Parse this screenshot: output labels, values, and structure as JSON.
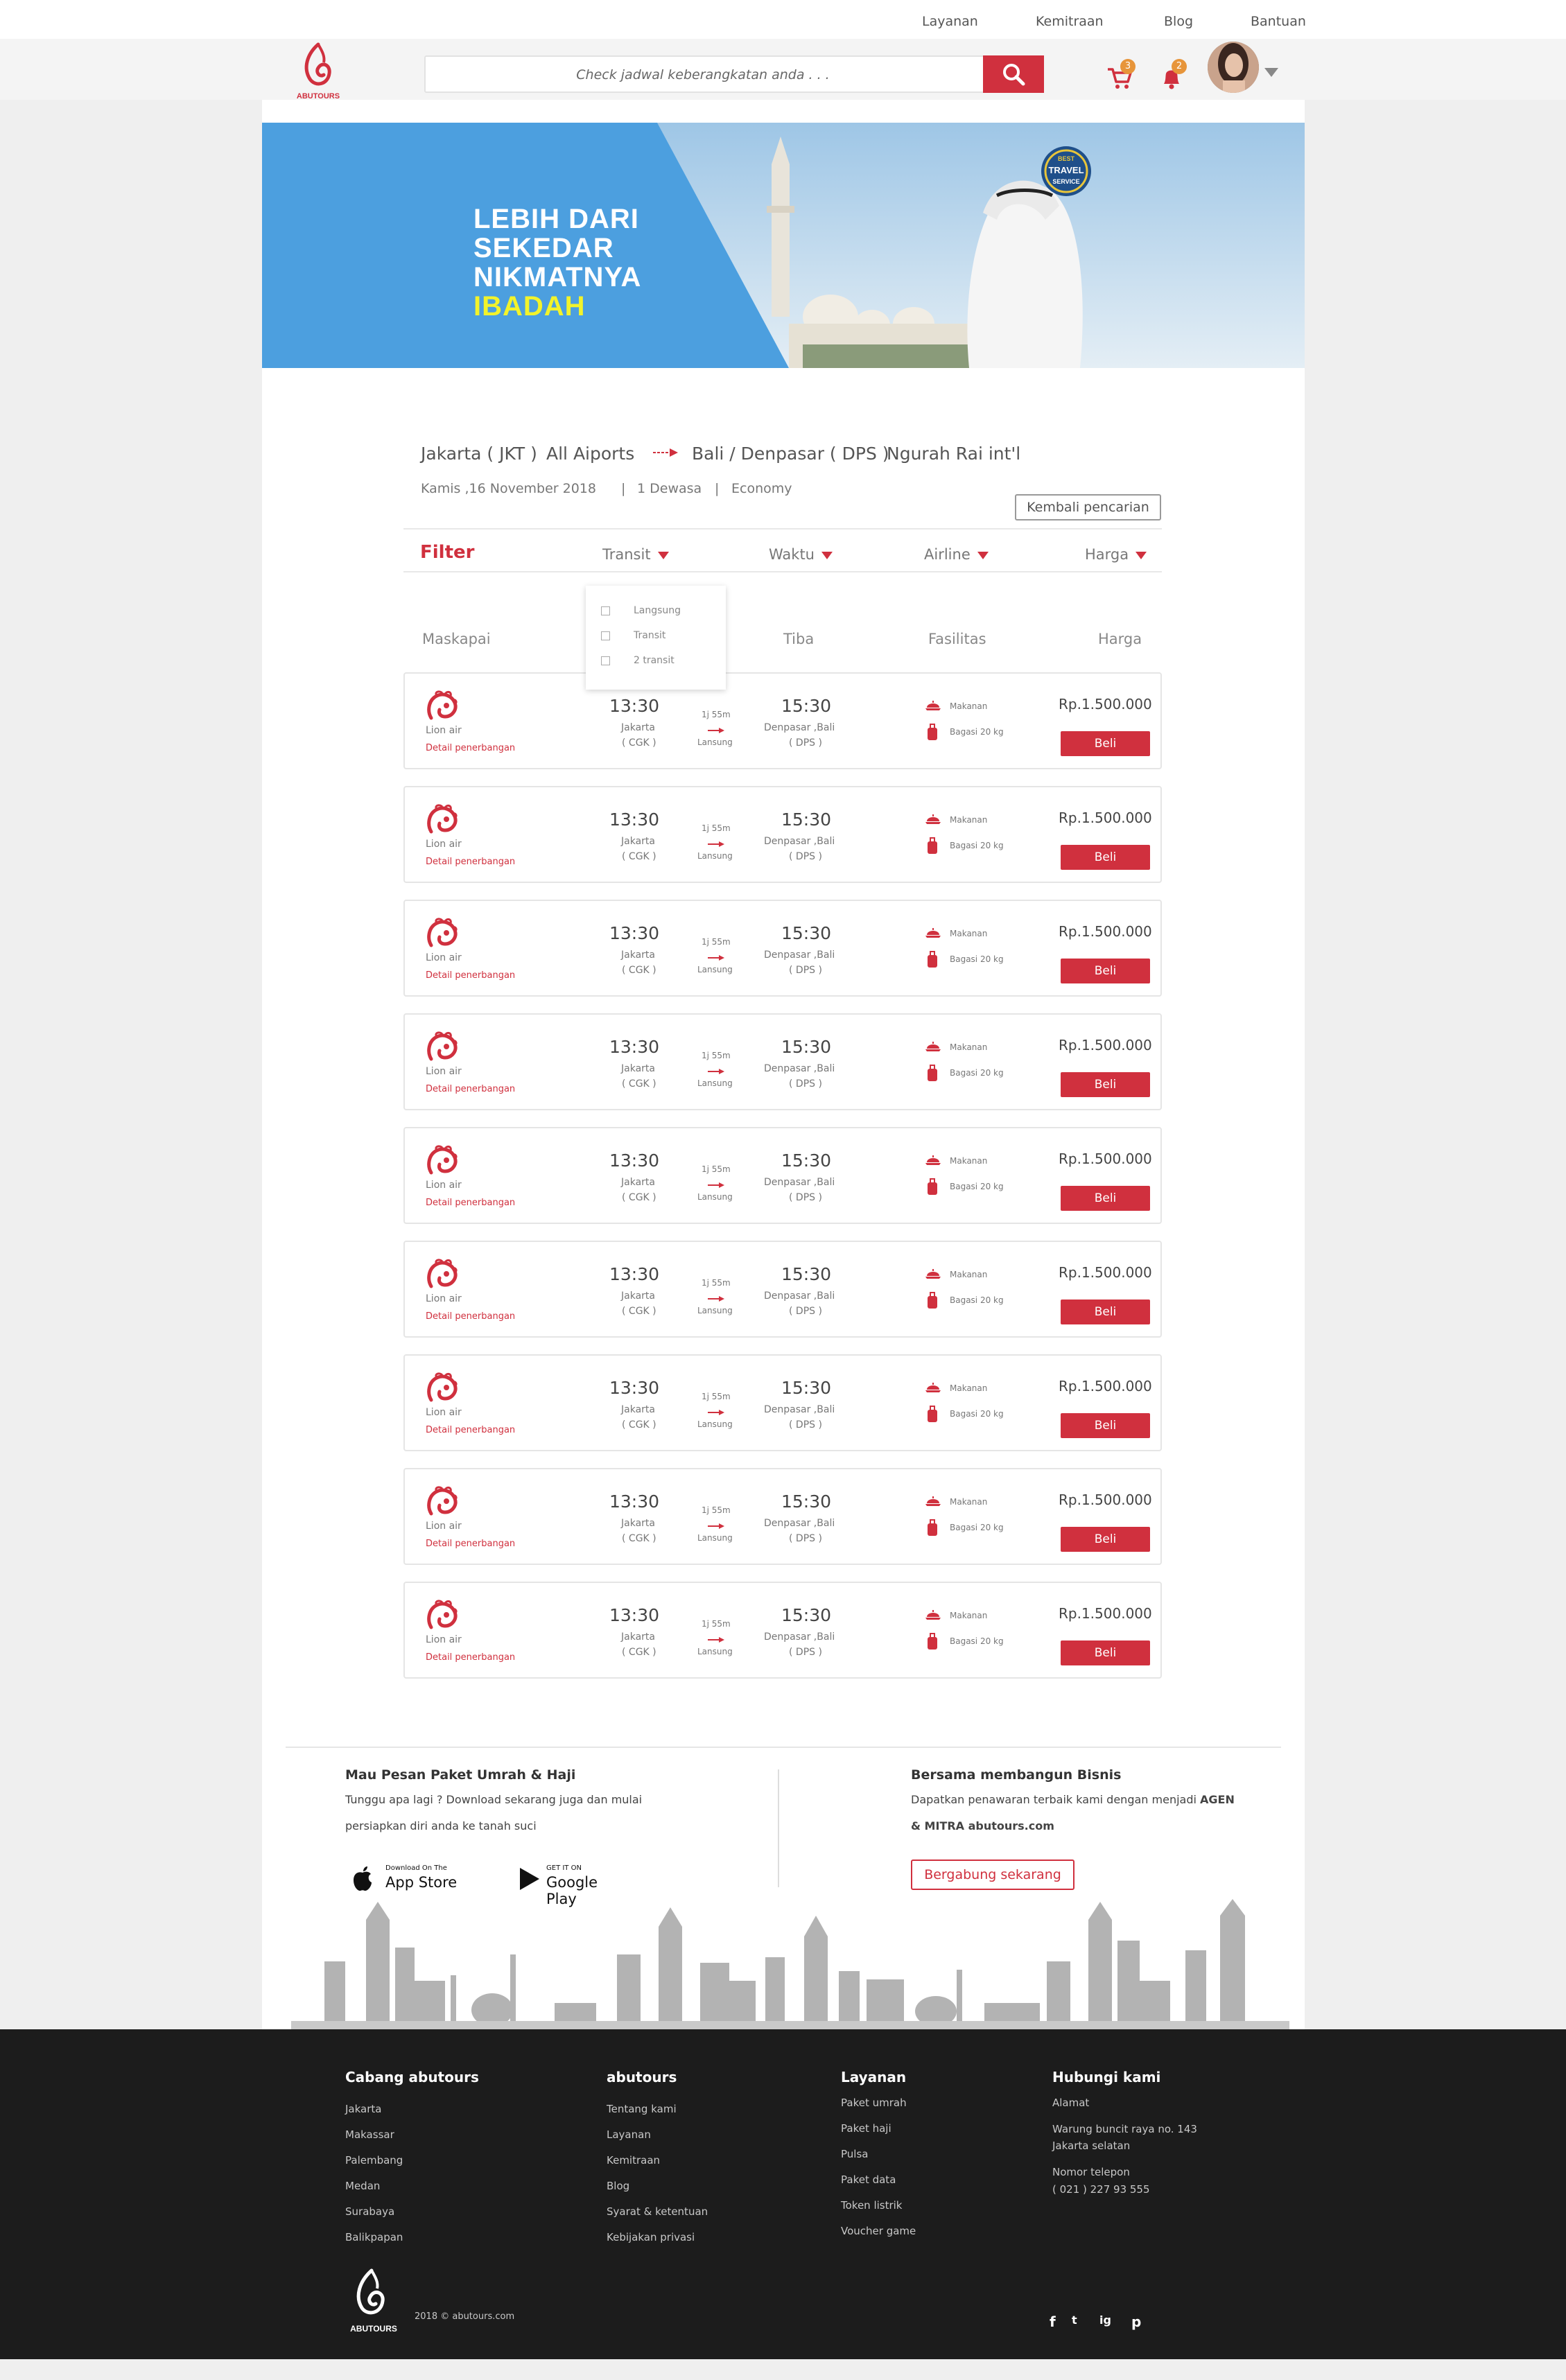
{
  "topnav": {
    "items": [
      "Layanan",
      "Kemitraan",
      "Blog",
      "Bantuan"
    ]
  },
  "header": {
    "logo_text": "ABUTOURS",
    "search_placeholder": "Check jadwal keberangkatan anda . . .",
    "cart_count": "3",
    "notif_count": "2"
  },
  "banner": {
    "line1": "LEBIH DARI",
    "line2": "SEKEDAR",
    "line3": "NIKMATNYA",
    "line4": "IBADAH",
    "seal_top": "BEST",
    "seal_mid": "TRAVEL",
    "seal_bot": "SERVICE"
  },
  "search_summary": {
    "origin": "Jakarta ( JKT )",
    "origin_airport": "All Aiports",
    "destination": "Bali / Denpasar ( DPS )",
    "destination_airport": "Ngurah Rai int'l",
    "date": "Kamis ,16 November 2018",
    "sep1": "|",
    "passengers": "1 Dewasa",
    "sep2": "|",
    "cabin": "Economy",
    "back_button": "Kembali pencarian"
  },
  "filter": {
    "title": "Filter",
    "options": [
      "Transit",
      "Waktu",
      "Airline",
      "Harga"
    ],
    "dropdown": [
      "Langsung",
      "Transit",
      "2 transit"
    ]
  },
  "columns": [
    "Maskapai",
    "Tiba",
    "Fasilitas",
    "Harga"
  ],
  "flights": [
    {
      "airline": "Lion air",
      "detail": "Detail penerbangan",
      "dep_time": "13:30",
      "dep_city": "Jakarta",
      "dep_code": "( CGK )",
      "duration": "1j 55m",
      "stops": "Lansung",
      "arr_time": "15:30",
      "arr_city": "Denpasar ,Bali",
      "arr_code": "( DPS )",
      "facility1": "Makanan",
      "facility2": "Bagasi 20 kg",
      "price": "Rp.1.500.000",
      "action": "Beli"
    },
    {
      "airline": "Lion air",
      "detail": "Detail penerbangan",
      "dep_time": "13:30",
      "dep_city": "Jakarta",
      "dep_code": "( CGK )",
      "duration": "1j 55m",
      "stops": "Lansung",
      "arr_time": "15:30",
      "arr_city": "Denpasar ,Bali",
      "arr_code": "( DPS )",
      "facility1": "Makanan",
      "facility2": "Bagasi 20 kg",
      "price": "Rp.1.500.000",
      "action": "Beli"
    },
    {
      "airline": "Lion air",
      "detail": "Detail penerbangan",
      "dep_time": "13:30",
      "dep_city": "Jakarta",
      "dep_code": "( CGK )",
      "duration": "1j 55m",
      "stops": "Lansung",
      "arr_time": "15:30",
      "arr_city": "Denpasar ,Bali",
      "arr_code": "( DPS )",
      "facility1": "Makanan",
      "facility2": "Bagasi 20 kg",
      "price": "Rp.1.500.000",
      "action": "Beli"
    },
    {
      "airline": "Lion air",
      "detail": "Detail penerbangan",
      "dep_time": "13:30",
      "dep_city": "Jakarta",
      "dep_code": "( CGK )",
      "duration": "1j 55m",
      "stops": "Lansung",
      "arr_time": "15:30",
      "arr_city": "Denpasar ,Bali",
      "arr_code": "( DPS )",
      "facility1": "Makanan",
      "facility2": "Bagasi 20 kg",
      "price": "Rp.1.500.000",
      "action": "Beli"
    },
    {
      "airline": "Lion air",
      "detail": "Detail penerbangan",
      "dep_time": "13:30",
      "dep_city": "Jakarta",
      "dep_code": "( CGK )",
      "duration": "1j 55m",
      "stops": "Lansung",
      "arr_time": "15:30",
      "arr_city": "Denpasar ,Bali",
      "arr_code": "( DPS )",
      "facility1": "Makanan",
      "facility2": "Bagasi 20 kg",
      "price": "Rp.1.500.000",
      "action": "Beli"
    },
    {
      "airline": "Lion air",
      "detail": "Detail penerbangan",
      "dep_time": "13:30",
      "dep_city": "Jakarta",
      "dep_code": "( CGK )",
      "duration": "1j 55m",
      "stops": "Lansung",
      "arr_time": "15:30",
      "arr_city": "Denpasar ,Bali",
      "arr_code": "( DPS )",
      "facility1": "Makanan",
      "facility2": "Bagasi 20 kg",
      "price": "Rp.1.500.000",
      "action": "Beli"
    },
    {
      "airline": "Lion air",
      "detail": "Detail penerbangan",
      "dep_time": "13:30",
      "dep_city": "Jakarta",
      "dep_code": "( CGK )",
      "duration": "1j 55m",
      "stops": "Lansung",
      "arr_time": "15:30",
      "arr_city": "Denpasar ,Bali",
      "arr_code": "( DPS )",
      "facility1": "Makanan",
      "facility2": "Bagasi 20 kg",
      "price": "Rp.1.500.000",
      "action": "Beli"
    },
    {
      "airline": "Lion air",
      "detail": "Detail penerbangan",
      "dep_time": "13:30",
      "dep_city": "Jakarta",
      "dep_code": "( CGK )",
      "duration": "1j 55m",
      "stops": "Lansung",
      "arr_time": "15:30",
      "arr_city": "Denpasar ,Bali",
      "arr_code": "( DPS )",
      "facility1": "Makanan",
      "facility2": "Bagasi 20 kg",
      "price": "Rp.1.500.000",
      "action": "Beli"
    },
    {
      "airline": "Lion air",
      "detail": "Detail penerbangan",
      "dep_time": "13:30",
      "dep_city": "Jakarta",
      "dep_code": "( CGK )",
      "duration": "1j 55m",
      "stops": "Lansung",
      "arr_time": "15:30",
      "arr_city": "Denpasar ,Bali",
      "arr_code": "( DPS )",
      "facility1": "Makanan",
      "facility2": "Bagasi 20 kg",
      "price": "Rp.1.500.000",
      "action": "Beli"
    }
  ],
  "promo": {
    "left_title": "Mau Pesan Paket Umrah & Haji",
    "left_text1": "Tunggu apa lagi ? Download sekarang juga dan mulai",
    "left_text2": "persiapkan diri anda ke tanah suci",
    "appstore_small": "Download On The",
    "appstore_big": "App Store",
    "gplay_small": "GET IT ON",
    "gplay_big": "Google Play",
    "right_title": "Bersama membangun Bisnis",
    "right_text1": "Dapatkan penawaran terbaik kami dengan menjadi",
    "right_text1_bold": "AGEN",
    "right_text2": "& MITRA abutours.com",
    "join_button": "Bergabung sekarang"
  },
  "footer": {
    "col1_title": "Cabang abutours",
    "col1_items": [
      "Jakarta",
      "Makassar",
      "Palembang",
      "Medan",
      "Surabaya",
      "Balikpapan"
    ],
    "col2_title": "abutours",
    "col2_items": [
      "Tentang kami",
      "Layanan",
      "Kemitraan",
      "Blog",
      "Syarat & ketentuan",
      "Kebijakan privasi"
    ],
    "col3_title": "Layanan",
    "col3_items": [
      "Paket umrah",
      "Paket haji",
      "Pulsa",
      "Paket data",
      "Token listrik",
      "Voucher game"
    ],
    "col4_title": "Hubungi kami",
    "col4_items": [
      "Alamat",
      "Warung buncit raya no. 143",
      "Jakarta selatan",
      "Nomor telepon",
      "( 021 )  227 93 555"
    ],
    "copyright": "2018 © abutours.com",
    "logo_text": "ABUTOURS",
    "social": [
      "f",
      "t",
      "ig",
      "p"
    ]
  },
  "colors": {
    "brand": "#d0303e",
    "banner_blue": "#4c9fdf",
    "footer": "#1c1c1c",
    "highlight": "#f2f32b"
  }
}
